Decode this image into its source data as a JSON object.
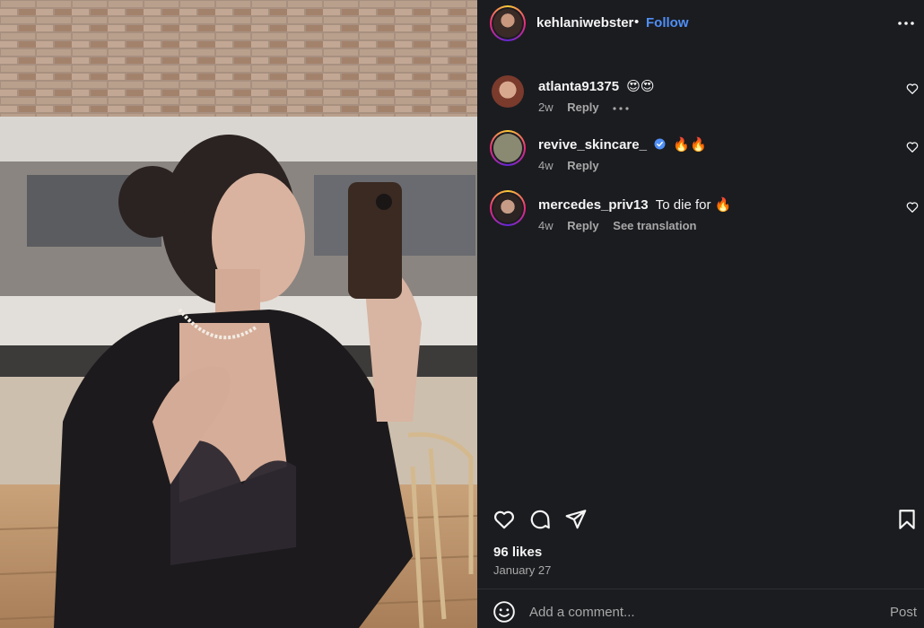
{
  "post": {
    "author": "kehlaniwebster",
    "separator": "•",
    "follow_label": "Follow"
  },
  "comments": [
    {
      "username": "atlanta91375",
      "text": "😍😍",
      "time": "2w",
      "reply_label": "Reply",
      "has_more": true,
      "translate_label": ""
    },
    {
      "username": "revive_skincare_",
      "text": "🔥🔥",
      "time": "4w",
      "reply_label": "Reply",
      "verified": true,
      "translate_label": ""
    },
    {
      "username": "mercedes_priv13",
      "text": "To die for 🔥",
      "time": "4w",
      "reply_label": "Reply",
      "translate_label": "See translation"
    }
  ],
  "stats": {
    "likes": "96 likes",
    "date": "January 27"
  },
  "composer": {
    "placeholder": "Add a comment...",
    "post_label": "Post"
  },
  "colors": {
    "background": "#1b1c20",
    "accent": "#4f8ff7",
    "muted": "#a8a8a8"
  },
  "icons": [
    "heart-icon",
    "comment-icon",
    "share-icon",
    "bookmark-icon",
    "emoji-icon",
    "more-icon",
    "verified-icon"
  ]
}
